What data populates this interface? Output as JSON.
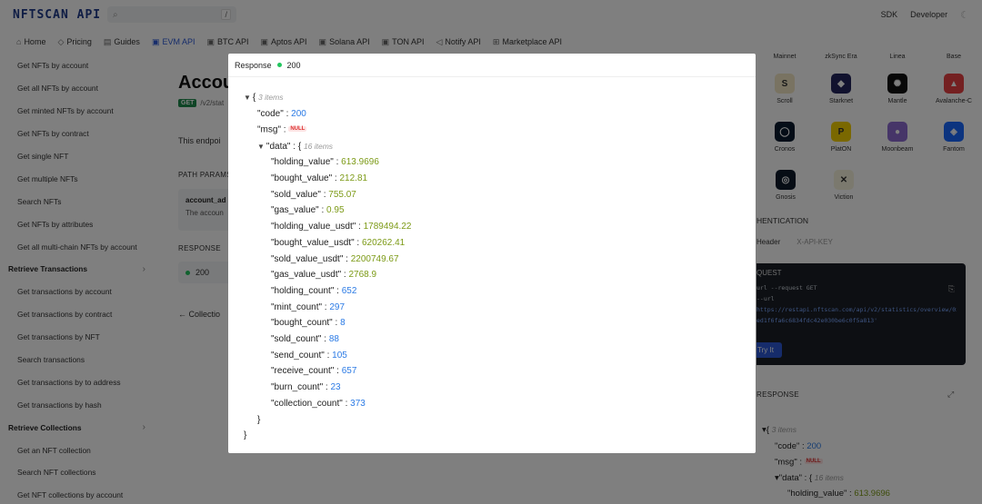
{
  "topbar": {
    "logo": "NFTSCAN API",
    "search_kbd": "/",
    "right_links": [
      "SDK",
      "Developer"
    ]
  },
  "nav": {
    "tabs": [
      {
        "label": "Home",
        "icon": "home-icon"
      },
      {
        "label": "Pricing",
        "icon": "tag-icon"
      },
      {
        "label": "Guides",
        "icon": "book-icon"
      },
      {
        "label": "EVM API",
        "icon": "code-icon",
        "active": true
      },
      {
        "label": "BTC API",
        "icon": "code-icon"
      },
      {
        "label": "Aptos API",
        "icon": "code-icon"
      },
      {
        "label": "Solana API",
        "icon": "code-icon"
      },
      {
        "label": "TON API",
        "icon": "code-icon"
      },
      {
        "label": "Notify API",
        "icon": "bell-icon"
      },
      {
        "label": "Marketplace API",
        "icon": "grid-icon"
      }
    ]
  },
  "sidebar": {
    "items": [
      {
        "type": "item",
        "label": "Get NFTs by account"
      },
      {
        "type": "item",
        "label": "Get all NFTs by account"
      },
      {
        "type": "item",
        "label": "Get minted NFTs by account"
      },
      {
        "type": "item",
        "label": "Get NFTs by contract"
      },
      {
        "type": "item",
        "label": "Get single NFT"
      },
      {
        "type": "item",
        "label": "Get multiple NFTs"
      },
      {
        "type": "item",
        "label": "Search NFTs"
      },
      {
        "type": "item",
        "label": "Get NFTs by attributes"
      },
      {
        "type": "item",
        "label": "Get all multi-chain NFTs by account"
      },
      {
        "type": "group",
        "label": "Retrieve Transactions"
      },
      {
        "type": "item",
        "label": "Get transactions by account"
      },
      {
        "type": "item",
        "label": "Get transactions by contract"
      },
      {
        "type": "item",
        "label": "Get transactions by NFT"
      },
      {
        "type": "item",
        "label": "Search transactions"
      },
      {
        "type": "item",
        "label": "Get transactions by to address"
      },
      {
        "type": "item",
        "label": "Get transactions by hash"
      },
      {
        "type": "group",
        "label": "Retrieve Collections"
      },
      {
        "type": "item",
        "label": "Get an NFT collection"
      },
      {
        "type": "item",
        "label": "Search NFT collections"
      },
      {
        "type": "item",
        "label": "Get NFT collections by account"
      }
    ]
  },
  "main": {
    "title": "Accou",
    "method": "GET",
    "path": "/v2/stat",
    "description": "This endpoi",
    "path_params_label": "PATH PARAMS",
    "param_name": "account_ad",
    "param_desc": "The accoun",
    "response_label": "RESPONSE",
    "response_code": "200",
    "back_link": "← Collectio"
  },
  "right": {
    "chain_headers": [
      "Mainnet",
      "zkSync Era",
      "Linea",
      "Base"
    ],
    "chains": [
      {
        "name": "Scroll",
        "color": "#f2e6c4",
        "glyph": "S"
      },
      {
        "name": "Starknet",
        "color": "#23245c",
        "glyph": "◆"
      },
      {
        "name": "Mantle",
        "color": "#111111",
        "glyph": "✺"
      },
      {
        "name": "Avalanche-C",
        "color": "#e84142",
        "glyph": "▲"
      },
      {
        "name": "Cronos",
        "color": "#0b1a2e",
        "glyph": "◯"
      },
      {
        "name": "PlatON",
        "color": "#f5d000",
        "glyph": "P"
      },
      {
        "name": "Moonbeam",
        "color": "#8c6bd1",
        "glyph": "●"
      },
      {
        "name": "Fantom",
        "color": "#1969ff",
        "glyph": "◈"
      },
      {
        "name": "Gnosis",
        "color": "#0e1a2b",
        "glyph": "◎"
      },
      {
        "name": "Viction",
        "color": "#f6f3dc",
        "glyph": "✕"
      }
    ],
    "auth_title": "HENTICATION",
    "auth_tabs": [
      "Header",
      "X-API-KEY"
    ],
    "request_title": "QUEST",
    "request_lines": [
      "url --request GET",
      "--url",
      "https://restapi.nftscan.com/api/v2/statistics/overview/0xca1257a",
      "ed1f6fa6c6834fdc42e030be6c0f5a813'"
    ],
    "try_label": "Try It",
    "response_title": "RESPONSE"
  },
  "modal": {
    "title": "Response",
    "status": "200",
    "root_count": "3 items",
    "code_key": "\"code\"",
    "code_val": "200",
    "msg_key": "\"msg\"",
    "null_label": "NULL",
    "data_key": "\"data\"",
    "data_count": "16 items",
    "fields": [
      {
        "key": "\"holding_value\"",
        "value": "613.9696",
        "kind": "dec"
      },
      {
        "key": "\"bought_value\"",
        "value": "212.81",
        "kind": "dec"
      },
      {
        "key": "\"sold_value\"",
        "value": "755.07",
        "kind": "dec"
      },
      {
        "key": "\"gas_value\"",
        "value": "0.95",
        "kind": "dec"
      },
      {
        "key": "\"holding_value_usdt\"",
        "value": "1789494.22",
        "kind": "dec"
      },
      {
        "key": "\"bought_value_usdt\"",
        "value": "620262.41",
        "kind": "dec"
      },
      {
        "key": "\"sold_value_usdt\"",
        "value": "2200749.67",
        "kind": "dec"
      },
      {
        "key": "\"gas_value_usdt\"",
        "value": "2768.9",
        "kind": "dec"
      },
      {
        "key": "\"holding_count\"",
        "value": "652",
        "kind": "int"
      },
      {
        "key": "\"mint_count\"",
        "value": "297",
        "kind": "int"
      },
      {
        "key": "\"bought_count\"",
        "value": "8",
        "kind": "int"
      },
      {
        "key": "\"sold_count\"",
        "value": "88",
        "kind": "int"
      },
      {
        "key": "\"send_count\"",
        "value": "105",
        "kind": "int"
      },
      {
        "key": "\"receive_count\"",
        "value": "657",
        "kind": "int"
      },
      {
        "key": "\"burn_count\"",
        "value": "23",
        "kind": "int"
      },
      {
        "key": "\"collection_count\"",
        "value": "373",
        "kind": "int"
      }
    ]
  },
  "colors": {
    "accent": "#2c59d6",
    "success": "#22c55e",
    "integer": "#2c7be5",
    "decimal": "#7c9a16",
    "null": "#d33333"
  }
}
